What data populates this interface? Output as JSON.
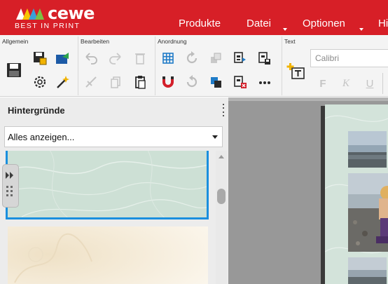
{
  "brand": {
    "name": "cewe",
    "tagline": "BEST IN PRINT"
  },
  "menu": {
    "items": [
      {
        "label": "Produkte",
        "has_dropdown": false
      },
      {
        "label": "Datei",
        "has_dropdown": true
      },
      {
        "label": "Optionen",
        "has_dropdown": true
      },
      {
        "label": "Hi",
        "has_dropdown": false
      }
    ]
  },
  "ribbon": {
    "groups": {
      "allgemein": {
        "title": "Allgemein",
        "buttons": [
          "save-icon",
          "save-as-icon",
          "export-icon",
          "settings-icon",
          "magic-wand-icon"
        ]
      },
      "bearbeiten": {
        "title": "Bearbeiten",
        "buttons": [
          "undo-icon",
          "redo-icon",
          "delete-icon",
          "cut-icon",
          "copy-icon",
          "paste-icon"
        ]
      },
      "anordnung": {
        "title": "Anordnung",
        "buttons": [
          "grid-icon",
          "rotate-icon",
          "bring-forward-icon",
          "align-icon",
          "save-layout-icon",
          "magnet-icon",
          "rotate-back-icon",
          "send-backward-icon",
          "remove-layout-icon",
          "more-icon"
        ]
      },
      "text": {
        "title": "Text",
        "buttons": [
          "add-text-icon",
          "bold-icon",
          "italic-icon",
          "underline-icon"
        ],
        "font_value": "Calibri",
        "bold_label": "F",
        "italic_label": "K",
        "underline_label": "U"
      }
    }
  },
  "left_panel": {
    "title": "Hintergründe",
    "filter": {
      "value": "Alles anzeigen...",
      "options_visible": [
        "Alles anzeigen..."
      ]
    }
  },
  "colors": {
    "brand_red": "#d71f27",
    "selection_blue": "#1a8fde",
    "panel_bg": "#ececec",
    "canvas_bg": "#989898",
    "page_bg": "#d3e3da"
  }
}
